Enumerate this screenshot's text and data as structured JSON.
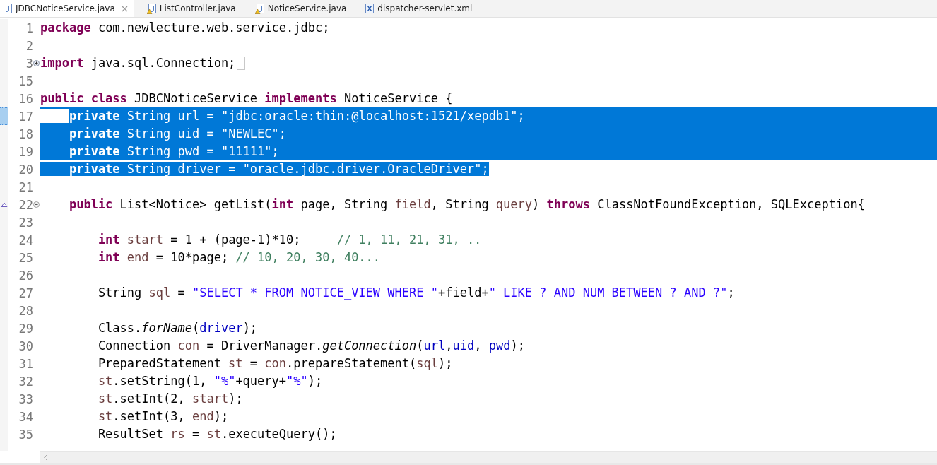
{
  "tabs": [
    {
      "label": "JDBCNoticeService.java",
      "kind": "java",
      "selected": true,
      "closable": true
    },
    {
      "label": "ListController.java",
      "kind": "java-warning",
      "selected": false,
      "closable": false
    },
    {
      "label": "NoticeService.java",
      "kind": "java-warning",
      "selected": false,
      "closable": false
    },
    {
      "label": "dispatcher-servlet.xml",
      "kind": "xml",
      "selected": false,
      "closable": false
    }
  ],
  "editor": {
    "lines": [
      {
        "number": "1",
        "selected": false,
        "tokens": [
          {
            "kind": "kw",
            "text": "package"
          },
          {
            "kind": "plain",
            "text": " com.newlecture.web.service.jdbc;"
          }
        ]
      },
      {
        "number": "2"
      },
      {
        "number": "3",
        "selected": false,
        "collapsed": true,
        "tokens": [
          {
            "kind": "kw",
            "text": "import"
          },
          {
            "kind": "plain",
            "text": " java.sql.Connection;"
          }
        ]
      },
      {
        "number": "15"
      },
      {
        "number": "16",
        "selected": false,
        "tokens": [
          {
            "kind": "kw",
            "text": "public class"
          },
          {
            "kind": "plain",
            "text": " JDBCNoticeService "
          },
          {
            "kind": "kw",
            "text": "implements"
          },
          {
            "kind": "plain",
            "text": " NoticeService {"
          }
        ]
      },
      {
        "number": "17",
        "selected": true,
        "occurrence": true,
        "tokens": [
          {
            "kind": "kw",
            "text": "    private"
          },
          {
            "kind": "plain",
            "text": " String "
          },
          {
            "kind": "field",
            "text": "url"
          },
          {
            "kind": "plain",
            "text": " = "
          },
          {
            "kind": "str",
            "text": "\"jdbc:oracle:thin:@localhost:1521/xepdb1\""
          },
          {
            "kind": "plain",
            "text": ";"
          }
        ]
      },
      {
        "number": "18",
        "selected": true,
        "tokens": [
          {
            "kind": "kw",
            "text": "    private"
          },
          {
            "kind": "plain",
            "text": " String "
          },
          {
            "kind": "field",
            "text": "uid"
          },
          {
            "kind": "plain",
            "text": " = "
          },
          {
            "kind": "str",
            "text": "\"NEWLEC\""
          },
          {
            "kind": "plain",
            "text": ";"
          }
        ]
      },
      {
        "number": "19",
        "selected": true,
        "tokens": [
          {
            "kind": "kw",
            "text": "    private"
          },
          {
            "kind": "plain",
            "text": " String "
          },
          {
            "kind": "field",
            "text": "pwd"
          },
          {
            "kind": "plain",
            "text": " = "
          },
          {
            "kind": "str",
            "text": "\"11111\""
          },
          {
            "kind": "plain",
            "text": ";"
          }
        ]
      },
      {
        "number": "20",
        "selected": true,
        "tokens": [
          {
            "kind": "kw",
            "text": "    private"
          },
          {
            "kind": "plain",
            "text": " String "
          },
          {
            "kind": "field",
            "text": "driver"
          },
          {
            "kind": "plain",
            "text": " = "
          },
          {
            "kind": "str",
            "text": "\"oracle.jdbc.driver.OracleDriver\""
          },
          {
            "kind": "plain",
            "text": ";"
          }
        ]
      },
      {
        "number": "21"
      },
      {
        "number": "22",
        "selected": false,
        "collapsed": false,
        "overrides": true,
        "tokens": [
          {
            "kind": "kw",
            "text": "    public"
          },
          {
            "kind": "plain",
            "text": " List<Notice> getList("
          },
          {
            "kind": "kw",
            "text": "int"
          },
          {
            "kind": "plain",
            "text": " page, String "
          },
          {
            "kind": "local",
            "text": "field"
          },
          {
            "kind": "plain",
            "text": ", String "
          },
          {
            "kind": "local",
            "text": "query"
          },
          {
            "kind": "plain",
            "text": ") "
          },
          {
            "kind": "kw",
            "text": "throws"
          },
          {
            "kind": "plain",
            "text": " ClassNotFoundException, SQLException{"
          }
        ]
      },
      {
        "number": "23"
      },
      {
        "number": "24",
        "selected": false,
        "tokens": [
          {
            "kind": "kw",
            "text": "        int"
          },
          {
            "kind": "local",
            "text": " start"
          },
          {
            "kind": "plain",
            "text": " = 1 + (page-1)*10;     "
          },
          {
            "kind": "comment",
            "text": "// 1, 11, 21, 31, .."
          }
        ]
      },
      {
        "number": "25",
        "selected": false,
        "tokens": [
          {
            "kind": "kw",
            "text": "        int"
          },
          {
            "kind": "local",
            "text": " end"
          },
          {
            "kind": "plain",
            "text": " = 10*page; "
          },
          {
            "kind": "comment",
            "text": "// 10, 20, 30, 40..."
          }
        ]
      },
      {
        "number": "26"
      },
      {
        "number": "27",
        "selected": false,
        "tokens": [
          {
            "kind": "plain",
            "text": "        String "
          },
          {
            "kind": "local",
            "text": "sql"
          },
          {
            "kind": "plain",
            "text": " = "
          },
          {
            "kind": "str",
            "text": "\"SELECT * FROM NOTICE_VIEW WHERE \""
          },
          {
            "kind": "plain",
            "text": "+field+"
          },
          {
            "kind": "str",
            "text": "\" LIKE ? AND NUM BETWEEN ? AND ?\""
          },
          {
            "kind": "plain",
            "text": ";"
          }
        ]
      },
      {
        "number": "28"
      },
      {
        "number": "29",
        "selected": false,
        "tokens": [
          {
            "kind": "plain",
            "text": "        Class."
          },
          {
            "kind": "static",
            "text": "forName"
          },
          {
            "kind": "plain",
            "text": "("
          },
          {
            "kind": "field",
            "text": "driver"
          },
          {
            "kind": "plain",
            "text": ");"
          }
        ]
      },
      {
        "number": "30",
        "selected": false,
        "tokens": [
          {
            "kind": "plain",
            "text": "        Connection "
          },
          {
            "kind": "local",
            "text": "con"
          },
          {
            "kind": "plain",
            "text": " = DriverManager."
          },
          {
            "kind": "static",
            "text": "getConnection"
          },
          {
            "kind": "plain",
            "text": "("
          },
          {
            "kind": "field",
            "text": "url"
          },
          {
            "kind": "plain",
            "text": ","
          },
          {
            "kind": "field",
            "text": "uid"
          },
          {
            "kind": "plain",
            "text": ", "
          },
          {
            "kind": "field",
            "text": "pwd"
          },
          {
            "kind": "plain",
            "text": ");"
          }
        ]
      },
      {
        "number": "31",
        "selected": false,
        "tokens": [
          {
            "kind": "plain",
            "text": "        PreparedStatement "
          },
          {
            "kind": "local",
            "text": "st"
          },
          {
            "kind": "plain",
            "text": " = "
          },
          {
            "kind": "local",
            "text": "con"
          },
          {
            "kind": "plain",
            "text": ".prepareStatement("
          },
          {
            "kind": "local",
            "text": "sql"
          },
          {
            "kind": "plain",
            "text": ");"
          }
        ]
      },
      {
        "number": "32",
        "selected": false,
        "tokens": [
          {
            "kind": "local",
            "text": "        st"
          },
          {
            "kind": "plain",
            "text": ".setString(1, "
          },
          {
            "kind": "str",
            "text": "\"%\""
          },
          {
            "kind": "plain",
            "text": "+query+"
          },
          {
            "kind": "str",
            "text": "\"%\""
          },
          {
            "kind": "plain",
            "text": ");"
          }
        ]
      },
      {
        "number": "33",
        "selected": false,
        "tokens": [
          {
            "kind": "local",
            "text": "        st"
          },
          {
            "kind": "plain",
            "text": ".setInt(2, "
          },
          {
            "kind": "local",
            "text": "start"
          },
          {
            "kind": "plain",
            "text": ");"
          }
        ]
      },
      {
        "number": "34",
        "selected": false,
        "tokens": [
          {
            "kind": "local",
            "text": "        st"
          },
          {
            "kind": "plain",
            "text": ".setInt(3, "
          },
          {
            "kind": "local",
            "text": "end"
          },
          {
            "kind": "plain",
            "text": ");"
          }
        ]
      },
      {
        "number": "35",
        "selected": false,
        "tokens": [
          {
            "kind": "plain",
            "text": "        ResultSet "
          },
          {
            "kind": "local",
            "text": "rs"
          },
          {
            "kind": "plain",
            "text": " = "
          },
          {
            "kind": "local",
            "text": "st"
          },
          {
            "kind": "plain",
            "text": ".executeQuery();"
          }
        ]
      }
    ]
  }
}
